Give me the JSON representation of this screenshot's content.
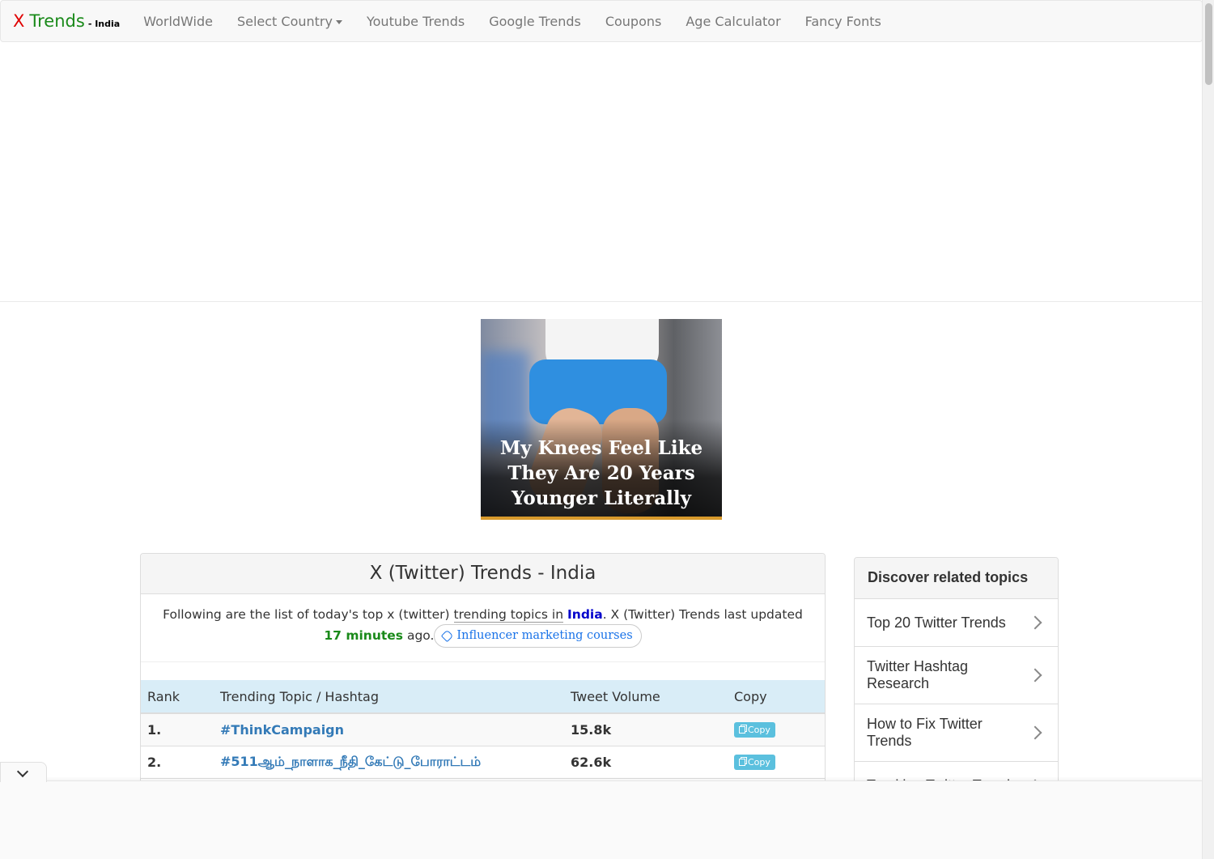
{
  "brand": {
    "x": "X",
    "trends": "Trends",
    "suffix": "- India"
  },
  "nav": {
    "items": [
      {
        "label": "WorldWide"
      },
      {
        "label": "Select Country"
      },
      {
        "label": "Youtube Trends"
      },
      {
        "label": "Google Trends"
      },
      {
        "label": "Coupons"
      },
      {
        "label": "Age Calculator"
      },
      {
        "label": "Fancy Fonts"
      }
    ]
  },
  "ad": {
    "caption": "My Knees Feel Like They Are 20 Years Younger Literally"
  },
  "panel": {
    "title": "X (Twitter) Trends - India",
    "intro_prefix": "Following are the list of today's top x (twitter) ",
    "intro_link": "trending topics in",
    "country": "India",
    "intro_mid": ". X (Twitter) Trends last updated ",
    "updated_value": "17 minutes",
    "intro_suffix": " ago.",
    "ad_chip": "Influencer marketing courses"
  },
  "table": {
    "headers": {
      "rank": "Rank",
      "topic": "Trending Topic / Hashtag",
      "volume": "Tweet Volume",
      "copy": "Copy"
    },
    "rows": [
      {
        "rank": "1.",
        "topic": "#ThinkCampaign",
        "volume": "15.8k",
        "copy": "Copy"
      },
      {
        "rank": "2.",
        "topic": "#511ஆம்_நாளாக_நீதி_கேட்டு_போராட்டம்",
        "volume": "62.6k",
        "copy": "Copy"
      }
    ]
  },
  "sidebar": {
    "title": "Discover related topics",
    "items": [
      {
        "label": "Top 20 Twitter Trends"
      },
      {
        "label": "Twitter Hashtag Research"
      },
      {
        "label": "How to Fix Twitter Trends"
      },
      {
        "label": "Tracking Twitter Trends"
      }
    ]
  },
  "icons": {
    "caret": "caret-down-icon",
    "tag": "tag-icon",
    "copy": "copy-icon",
    "chevron": "chevron-right-icon",
    "collapse": "chevron-down-icon"
  },
  "colors": {
    "brand_x": "#e00000",
    "brand_trends": "#1a8a1a",
    "link": "#337ab7",
    "country": "#0000cc",
    "updated": "#1a8a1a",
    "table_header": "#d9edf7",
    "copy_button": "#5bc0de"
  }
}
